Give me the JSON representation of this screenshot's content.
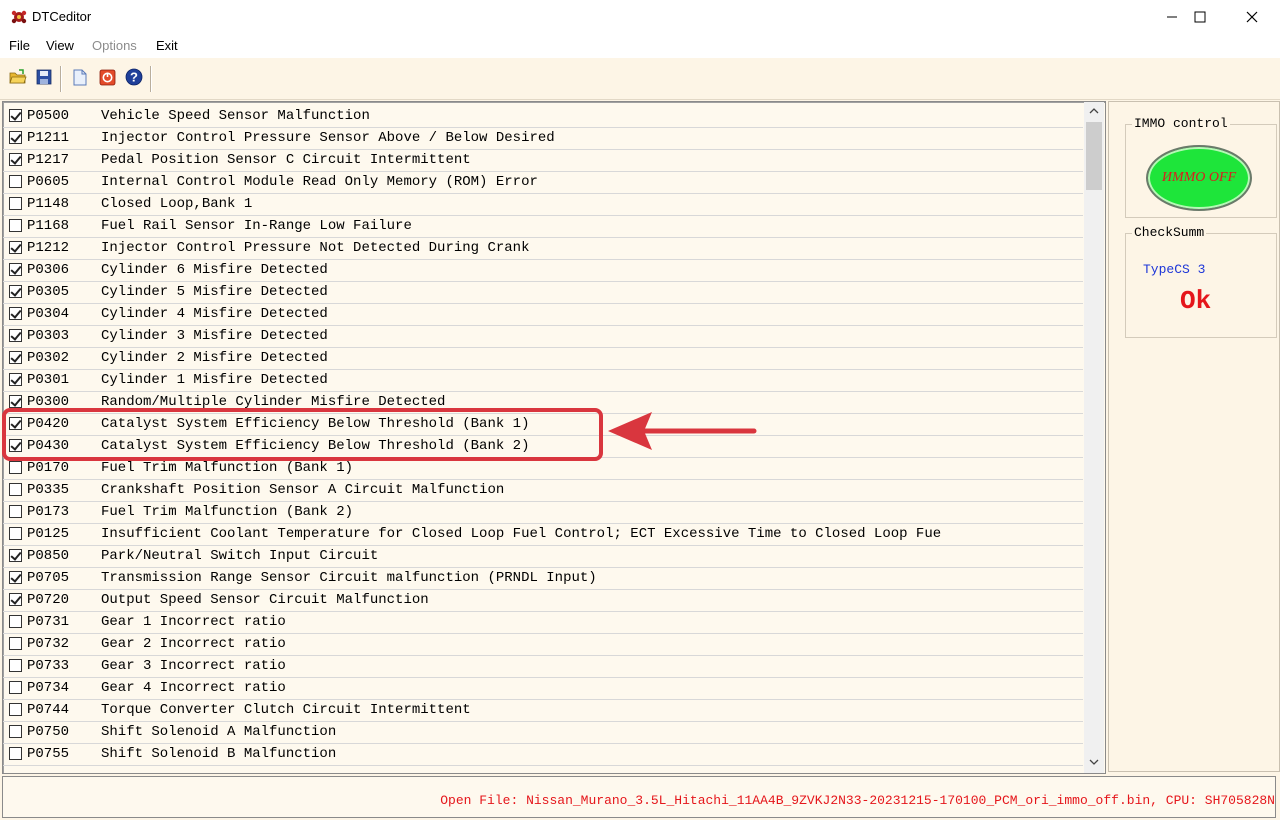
{
  "window": {
    "title": "DTCeditor"
  },
  "menu": [
    {
      "label": "File",
      "enabled": true
    },
    {
      "label": "View",
      "enabled": true
    },
    {
      "label": "Options",
      "enabled": false
    },
    {
      "label": "Exit",
      "enabled": true
    }
  ],
  "toolbar": {
    "icons": [
      "open-folder-icon",
      "save-icon",
      "new-document-icon",
      "stop-icon",
      "help-icon"
    ]
  },
  "dtc_list": [
    {
      "checked": true,
      "code": "P0500",
      "description": "Vehicle Speed Sensor Malfunction"
    },
    {
      "checked": true,
      "code": "P1211",
      "description": "Injector Control Pressure Sensor Above / Below Desired"
    },
    {
      "checked": true,
      "code": "P1217",
      "description": "Pedal Position Sensor C Circuit Intermittent"
    },
    {
      "checked": false,
      "code": "P0605",
      "description": "Internal Control Module Read Only Memory (ROM) Error"
    },
    {
      "checked": false,
      "code": "P1148",
      "description": "Closed Loop,Bank 1"
    },
    {
      "checked": false,
      "code": "P1168",
      "description": "Fuel Rail Sensor In-Range Low Failure"
    },
    {
      "checked": true,
      "code": "P1212",
      "description": "Injector Control Pressure Not Detected During Crank"
    },
    {
      "checked": true,
      "code": "P0306",
      "description": "Cylinder 6 Misfire Detected"
    },
    {
      "checked": true,
      "code": "P0305",
      "description": "Cylinder 5 Misfire Detected"
    },
    {
      "checked": true,
      "code": "P0304",
      "description": "Cylinder 4 Misfire Detected"
    },
    {
      "checked": true,
      "code": "P0303",
      "description": "Cylinder 3 Misfire Detected"
    },
    {
      "checked": true,
      "code": "P0302",
      "description": "Cylinder 2 Misfire Detected"
    },
    {
      "checked": true,
      "code": "P0301",
      "description": "Cylinder 1 Misfire Detected"
    },
    {
      "checked": true,
      "code": "P0300",
      "description": "Random/Multiple Cylinder Misfire Detected"
    },
    {
      "checked": true,
      "code": "P0420",
      "description": "Catalyst System Efficiency Below Threshold (Bank 1)"
    },
    {
      "checked": true,
      "code": "P0430",
      "description": "Catalyst System Efficiency Below Threshold (Bank 2)"
    },
    {
      "checked": false,
      "code": "P0170",
      "description": "Fuel Trim Malfunction (Bank 1)"
    },
    {
      "checked": false,
      "code": "P0335",
      "description": "Crankshaft Position Sensor A Circuit Malfunction"
    },
    {
      "checked": false,
      "code": "P0173",
      "description": "Fuel Trim Malfunction (Bank 2)"
    },
    {
      "checked": false,
      "code": "P0125",
      "description": "Insufficient Coolant Temperature for Closed Loop Fuel Control; ECT Excessive Time to Closed Loop Fue"
    },
    {
      "checked": true,
      "code": "P0850",
      "description": "Park/Neutral Switch Input Circuit"
    },
    {
      "checked": true,
      "code": "P0705",
      "description": "Transmission Range Sensor Circuit malfunction (PRNDL Input)"
    },
    {
      "checked": true,
      "code": "P0720",
      "description": "Output Speed Sensor Circuit Malfunction"
    },
    {
      "checked": false,
      "code": "P0731",
      "description": "Gear 1 Incorrect ratio"
    },
    {
      "checked": false,
      "code": "P0732",
      "description": "Gear 2 Incorrect ratio"
    },
    {
      "checked": false,
      "code": "P0733",
      "description": "Gear 3 Incorrect ratio"
    },
    {
      "checked": false,
      "code": "P0734",
      "description": "Gear 4 Incorrect ratio"
    },
    {
      "checked": false,
      "code": "P0744",
      "description": "Torque Converter Clutch Circuit Intermittent"
    },
    {
      "checked": false,
      "code": "P0750",
      "description": "Shift Solenoid A Malfunction"
    },
    {
      "checked": false,
      "code": "P0755",
      "description": "Shift Solenoid B Malfunction"
    }
  ],
  "immo": {
    "group_label": "IMMO control",
    "button_label": "ИММО OFF",
    "color": "#1ee53a"
  },
  "checksum": {
    "group_label": "CheckSumm",
    "type_label": "TypeCS 3",
    "status": "Ok"
  },
  "status_bar": {
    "text": "Open File: Nissan_Murano_3.5L_Hitachi_11AA4B_9ZVKJ2N33-20231215-170100_PCM_ori_immo_off.bin, CPU: SH705828N"
  },
  "colors": {
    "background": "#fdf5e6",
    "highlight": "#d9363e",
    "status_text": "#e5161b",
    "typecs_text": "#1d36d8"
  }
}
